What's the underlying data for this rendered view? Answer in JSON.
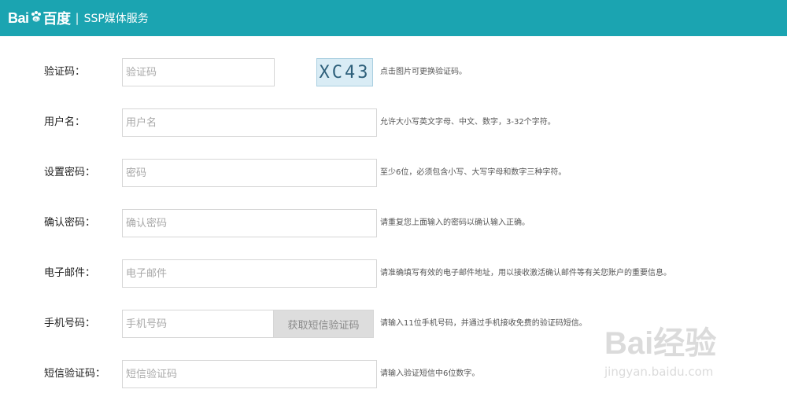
{
  "header": {
    "logo_text_left": "Bai",
    "logo_text_right": "百度",
    "separator": "|",
    "title": "SSP媒体服务"
  },
  "form": {
    "captcha": {
      "label": "验证码：",
      "placeholder": "验证码",
      "image_text": "XC43",
      "hint": "点击图片可更换验证码。"
    },
    "username": {
      "label": "用户名：",
      "placeholder": "用户名",
      "hint": "允许大小写英文字母、中文、数字，3-32个字符。"
    },
    "password": {
      "label": "设置密码：",
      "placeholder": "密码",
      "hint": "至少6位，必须包含小写、大写字母和数字三种字符。"
    },
    "confirm_password": {
      "label": "确认密码：",
      "placeholder": "确认密码",
      "hint": "请重复您上面输入的密码以确认输入正确。"
    },
    "email": {
      "label": "电子邮件：",
      "placeholder": "电子邮件",
      "hint": "请准确填写有效的电子邮件地址，用以接收激活确认邮件等有关您账户的重要信息。"
    },
    "phone": {
      "label": "手机号码：",
      "placeholder": "手机号码",
      "button": "获取短信验证码",
      "hint": "请输入11位手机号码，并通过手机接收免费的验证码短信。"
    },
    "sms_code": {
      "label": "短信验证码：",
      "placeholder": "短信验证码",
      "hint": "请输入验证短信中6位数字。"
    }
  },
  "watermark": {
    "line1": "Bai经验",
    "line2": "jingyan.baidu.com"
  },
  "colors": {
    "header_bg": "#1ba4b1",
    "input_border": "#d6d6d6",
    "button_bg": "#dddddd"
  }
}
